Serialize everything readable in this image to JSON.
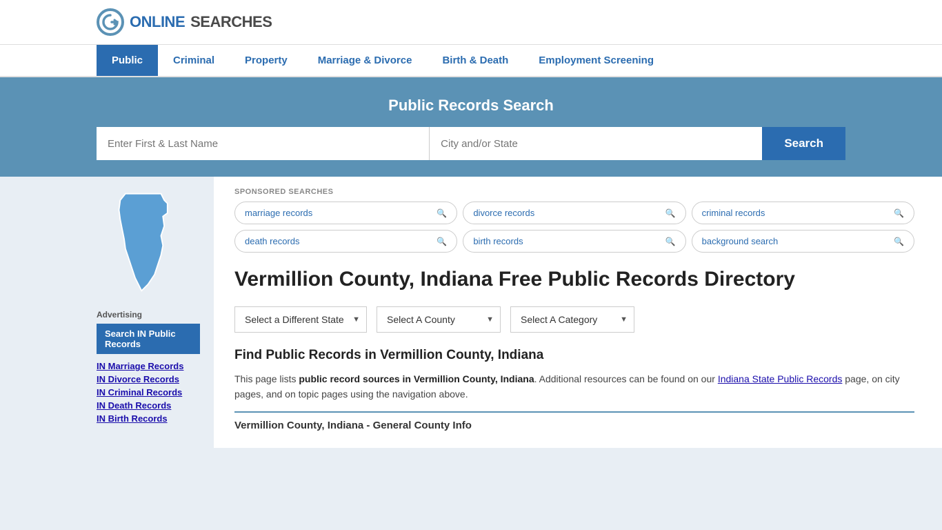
{
  "logo": {
    "text_online": "ONLINE",
    "text_searches": "SEARCHES"
  },
  "nav": {
    "items": [
      {
        "label": "Public",
        "active": true
      },
      {
        "label": "Criminal",
        "active": false
      },
      {
        "label": "Property",
        "active": false
      },
      {
        "label": "Marriage & Divorce",
        "active": false
      },
      {
        "label": "Birth & Death",
        "active": false
      },
      {
        "label": "Employment Screening",
        "active": false
      }
    ]
  },
  "search_banner": {
    "title": "Public Records Search",
    "name_placeholder": "Enter First & Last Name",
    "location_placeholder": "City and/or State",
    "button_label": "Search"
  },
  "sponsored": {
    "label": "SPONSORED SEARCHES",
    "pills": [
      {
        "text": "marriage records"
      },
      {
        "text": "divorce records"
      },
      {
        "text": "criminal records"
      },
      {
        "text": "death records"
      },
      {
        "text": "birth records"
      },
      {
        "text": "background search"
      }
    ]
  },
  "page": {
    "title": "Vermillion County, Indiana Free Public Records Directory",
    "dropdowns": {
      "state": "Select a Different State",
      "county": "Select A County",
      "category": "Select A Category"
    },
    "section_title": "Find Public Records in Vermillion County, Indiana",
    "body_text_1": "This page lists ",
    "body_text_bold": "public record sources in Vermillion County, Indiana",
    "body_text_2": ". Additional resources can be found on our ",
    "body_link": "Indiana State Public Records",
    "body_text_3": " page, on city pages, and on topic pages using the navigation above.",
    "county_info_title": "Vermillion County, Indiana - General County Info"
  },
  "sidebar": {
    "advertising_label": "Advertising",
    "ad_button_label": "Search IN Public Records",
    "links": [
      {
        "label": "IN Marriage Records"
      },
      {
        "label": "IN Divorce Records"
      },
      {
        "label": "IN Criminal Records"
      },
      {
        "label": "IN Death Records"
      },
      {
        "label": "IN Birth Records"
      }
    ]
  }
}
